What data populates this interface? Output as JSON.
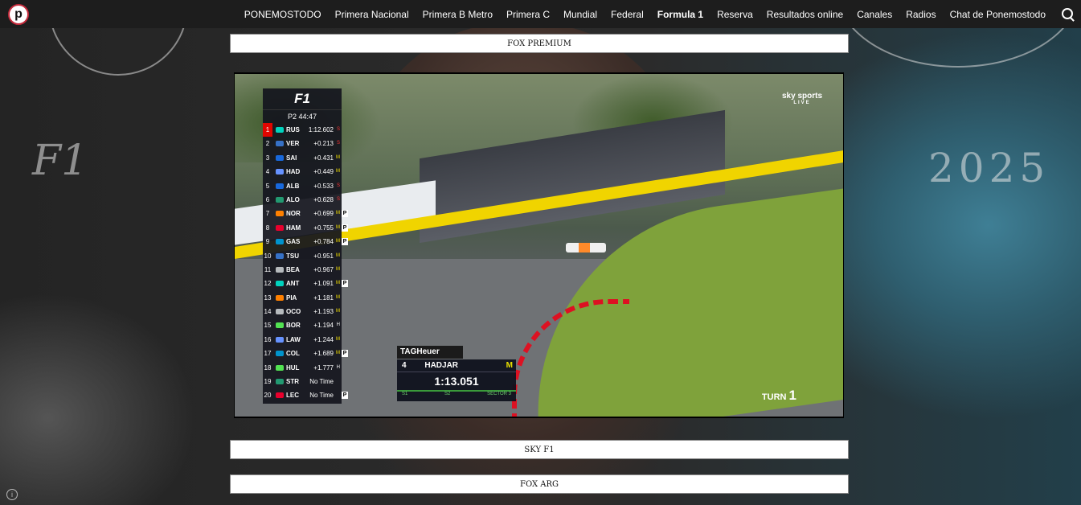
{
  "nav": {
    "logo_letter": "p",
    "items": [
      "PONEMOSTODO",
      "Primera Nacional",
      "Primera B Metro",
      "Primera C",
      "Mundial",
      "Federal",
      "Formula 1",
      "Reserva",
      "Resultados online",
      "Canales",
      "Radios",
      "Chat de Ponemostodo"
    ],
    "active_item": "Formula 1"
  },
  "background": {
    "left_text": "F1",
    "right_text": "2025"
  },
  "channels": {
    "top": "FOX PREMIUM",
    "middle": "SKY F1",
    "bottom": "FOX ARG"
  },
  "player": {
    "session": "P2 44:47",
    "f1_logo": "F1",
    "broadcaster": "sky sports",
    "live": "LIVE",
    "turn_label": "TURN",
    "turn_number": "1",
    "leaderboard": [
      {
        "pos": "1",
        "code": "RUS",
        "gap": "1:12.602",
        "tyre": "S",
        "team_color": "#00d2be",
        "pit": ""
      },
      {
        "pos": "2",
        "code": "VER",
        "gap": "+0.213",
        "tyre": "S",
        "team_color": "#3671c6",
        "pit": ""
      },
      {
        "pos": "3",
        "code": "SAI",
        "gap": "+0.431",
        "tyre": "M",
        "team_color": "#1868db",
        "pit": ""
      },
      {
        "pos": "4",
        "code": "HAD",
        "gap": "+0.449",
        "tyre": "M",
        "team_color": "#6692ff",
        "pit": ""
      },
      {
        "pos": "5",
        "code": "ALB",
        "gap": "+0.533",
        "tyre": "S",
        "team_color": "#1868db",
        "pit": ""
      },
      {
        "pos": "6",
        "code": "ALO",
        "gap": "+0.628",
        "tyre": "S",
        "team_color": "#229971",
        "pit": ""
      },
      {
        "pos": "7",
        "code": "NOR",
        "gap": "+0.699",
        "tyre": "M",
        "team_color": "#ff8000",
        "pit": "P"
      },
      {
        "pos": "8",
        "code": "HAM",
        "gap": "+0.755",
        "tyre": "M",
        "team_color": "#e8002d",
        "pit": "P"
      },
      {
        "pos": "9",
        "code": "GAS",
        "gap": "+0.784",
        "tyre": "M",
        "team_color": "#0093cc",
        "pit": "P"
      },
      {
        "pos": "10",
        "code": "TSU",
        "gap": "+0.951",
        "tyre": "M",
        "team_color": "#3671c6",
        "pit": ""
      },
      {
        "pos": "11",
        "code": "BEA",
        "gap": "+0.967",
        "tyre": "M",
        "team_color": "#b6babd",
        "pit": ""
      },
      {
        "pos": "12",
        "code": "ANT",
        "gap": "+1.091",
        "tyre": "M",
        "team_color": "#00d2be",
        "pit": "P"
      },
      {
        "pos": "13",
        "code": "PIA",
        "gap": "+1.181",
        "tyre": "M",
        "team_color": "#ff8000",
        "pit": ""
      },
      {
        "pos": "14",
        "code": "OCO",
        "gap": "+1.193",
        "tyre": "M",
        "team_color": "#b6babd",
        "pit": ""
      },
      {
        "pos": "15",
        "code": "BOR",
        "gap": "+1.194",
        "tyre": "H",
        "team_color": "#52e252",
        "pit": ""
      },
      {
        "pos": "16",
        "code": "LAW",
        "gap": "+1.244",
        "tyre": "M",
        "team_color": "#6692ff",
        "pit": ""
      },
      {
        "pos": "17",
        "code": "COL",
        "gap": "+1.689",
        "tyre": "M",
        "team_color": "#0093cc",
        "pit": "P"
      },
      {
        "pos": "18",
        "code": "HUL",
        "gap": "+1.777",
        "tyre": "H",
        "team_color": "#52e252",
        "pit": ""
      },
      {
        "pos": "19",
        "code": "STR",
        "gap": "No Time",
        "tyre": "",
        "team_color": "#229971",
        "pit": ""
      },
      {
        "pos": "20",
        "code": "LEC",
        "gap": "No Time",
        "tyre": "",
        "team_color": "#e8002d",
        "pit": "P"
      }
    ],
    "timing": {
      "sponsor": "TAGHeuer",
      "driver_number": "4",
      "driver_name": "HADJAR",
      "tyre": "M",
      "lap_time": "1:13.051",
      "sectors": [
        "S1",
        "S2",
        "SECTOR 3"
      ]
    }
  },
  "colors": {
    "nav_bg": "#1d1d1d",
    "p1": "#e10600",
    "logo_ring": "#c42a3b"
  }
}
